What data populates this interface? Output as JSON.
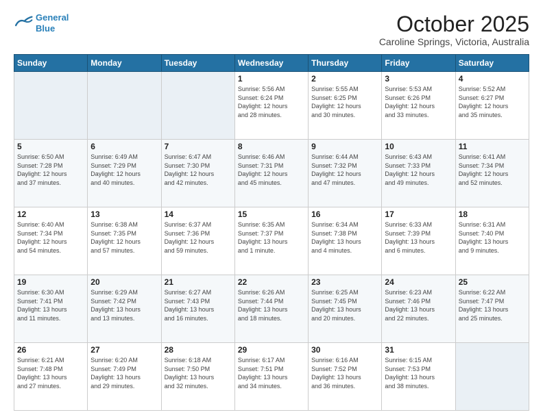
{
  "header": {
    "logo_line1": "General",
    "logo_line2": "Blue",
    "month": "October 2025",
    "location": "Caroline Springs, Victoria, Australia"
  },
  "weekdays": [
    "Sunday",
    "Monday",
    "Tuesday",
    "Wednesday",
    "Thursday",
    "Friday",
    "Saturday"
  ],
  "rows": [
    [
      {
        "day": "",
        "info": ""
      },
      {
        "day": "",
        "info": ""
      },
      {
        "day": "",
        "info": ""
      },
      {
        "day": "1",
        "info": "Sunrise: 5:56 AM\nSunset: 6:24 PM\nDaylight: 12 hours\nand 28 minutes."
      },
      {
        "day": "2",
        "info": "Sunrise: 5:55 AM\nSunset: 6:25 PM\nDaylight: 12 hours\nand 30 minutes."
      },
      {
        "day": "3",
        "info": "Sunrise: 5:53 AM\nSunset: 6:26 PM\nDaylight: 12 hours\nand 33 minutes."
      },
      {
        "day": "4",
        "info": "Sunrise: 5:52 AM\nSunset: 6:27 PM\nDaylight: 12 hours\nand 35 minutes."
      }
    ],
    [
      {
        "day": "5",
        "info": "Sunrise: 6:50 AM\nSunset: 7:28 PM\nDaylight: 12 hours\nand 37 minutes."
      },
      {
        "day": "6",
        "info": "Sunrise: 6:49 AM\nSunset: 7:29 PM\nDaylight: 12 hours\nand 40 minutes."
      },
      {
        "day": "7",
        "info": "Sunrise: 6:47 AM\nSunset: 7:30 PM\nDaylight: 12 hours\nand 42 minutes."
      },
      {
        "day": "8",
        "info": "Sunrise: 6:46 AM\nSunset: 7:31 PM\nDaylight: 12 hours\nand 45 minutes."
      },
      {
        "day": "9",
        "info": "Sunrise: 6:44 AM\nSunset: 7:32 PM\nDaylight: 12 hours\nand 47 minutes."
      },
      {
        "day": "10",
        "info": "Sunrise: 6:43 AM\nSunset: 7:33 PM\nDaylight: 12 hours\nand 49 minutes."
      },
      {
        "day": "11",
        "info": "Sunrise: 6:41 AM\nSunset: 7:34 PM\nDaylight: 12 hours\nand 52 minutes."
      }
    ],
    [
      {
        "day": "12",
        "info": "Sunrise: 6:40 AM\nSunset: 7:34 PM\nDaylight: 12 hours\nand 54 minutes."
      },
      {
        "day": "13",
        "info": "Sunrise: 6:38 AM\nSunset: 7:35 PM\nDaylight: 12 hours\nand 57 minutes."
      },
      {
        "day": "14",
        "info": "Sunrise: 6:37 AM\nSunset: 7:36 PM\nDaylight: 12 hours\nand 59 minutes."
      },
      {
        "day": "15",
        "info": "Sunrise: 6:35 AM\nSunset: 7:37 PM\nDaylight: 13 hours\nand 1 minute."
      },
      {
        "day": "16",
        "info": "Sunrise: 6:34 AM\nSunset: 7:38 PM\nDaylight: 13 hours\nand 4 minutes."
      },
      {
        "day": "17",
        "info": "Sunrise: 6:33 AM\nSunset: 7:39 PM\nDaylight: 13 hours\nand 6 minutes."
      },
      {
        "day": "18",
        "info": "Sunrise: 6:31 AM\nSunset: 7:40 PM\nDaylight: 13 hours\nand 9 minutes."
      }
    ],
    [
      {
        "day": "19",
        "info": "Sunrise: 6:30 AM\nSunset: 7:41 PM\nDaylight: 13 hours\nand 11 minutes."
      },
      {
        "day": "20",
        "info": "Sunrise: 6:29 AM\nSunset: 7:42 PM\nDaylight: 13 hours\nand 13 minutes."
      },
      {
        "day": "21",
        "info": "Sunrise: 6:27 AM\nSunset: 7:43 PM\nDaylight: 13 hours\nand 16 minutes."
      },
      {
        "day": "22",
        "info": "Sunrise: 6:26 AM\nSunset: 7:44 PM\nDaylight: 13 hours\nand 18 minutes."
      },
      {
        "day": "23",
        "info": "Sunrise: 6:25 AM\nSunset: 7:45 PM\nDaylight: 13 hours\nand 20 minutes."
      },
      {
        "day": "24",
        "info": "Sunrise: 6:23 AM\nSunset: 7:46 PM\nDaylight: 13 hours\nand 22 minutes."
      },
      {
        "day": "25",
        "info": "Sunrise: 6:22 AM\nSunset: 7:47 PM\nDaylight: 13 hours\nand 25 minutes."
      }
    ],
    [
      {
        "day": "26",
        "info": "Sunrise: 6:21 AM\nSunset: 7:48 PM\nDaylight: 13 hours\nand 27 minutes."
      },
      {
        "day": "27",
        "info": "Sunrise: 6:20 AM\nSunset: 7:49 PM\nDaylight: 13 hours\nand 29 minutes."
      },
      {
        "day": "28",
        "info": "Sunrise: 6:18 AM\nSunset: 7:50 PM\nDaylight: 13 hours\nand 32 minutes."
      },
      {
        "day": "29",
        "info": "Sunrise: 6:17 AM\nSunset: 7:51 PM\nDaylight: 13 hours\nand 34 minutes."
      },
      {
        "day": "30",
        "info": "Sunrise: 6:16 AM\nSunset: 7:52 PM\nDaylight: 13 hours\nand 36 minutes."
      },
      {
        "day": "31",
        "info": "Sunrise: 6:15 AM\nSunset: 7:53 PM\nDaylight: 13 hours\nand 38 minutes."
      },
      {
        "day": "",
        "info": ""
      }
    ]
  ]
}
